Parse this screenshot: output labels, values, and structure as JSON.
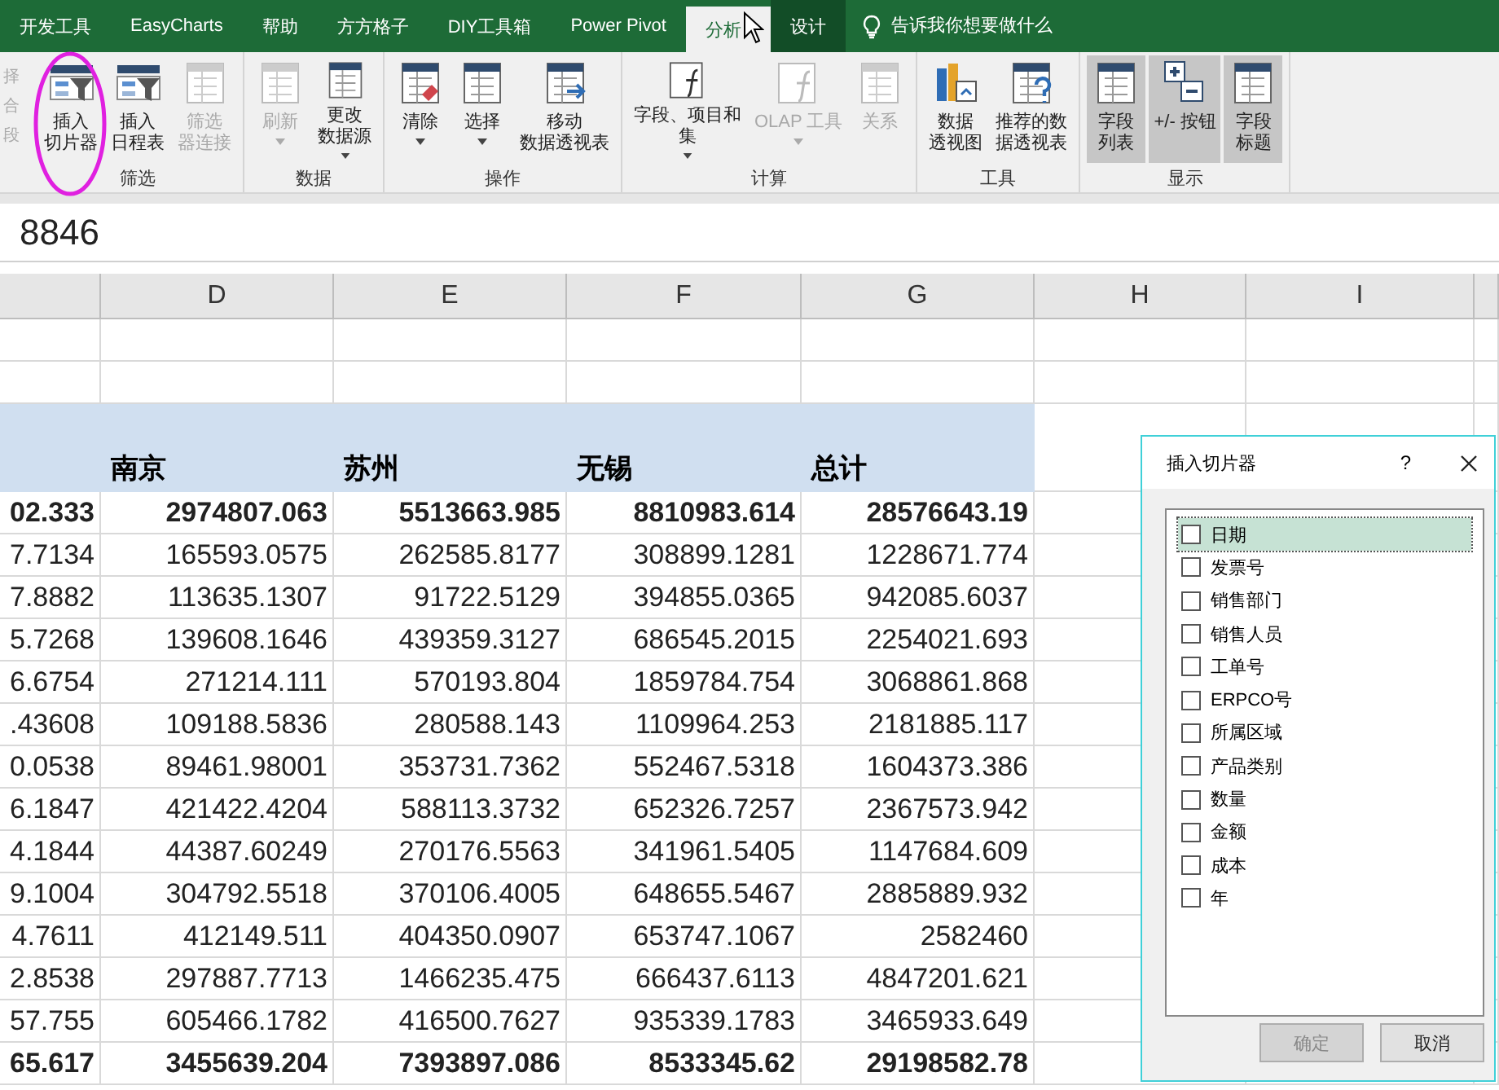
{
  "tabs": [
    {
      "label": "开发工具",
      "selected": false,
      "contextual": false
    },
    {
      "label": "EasyCharts",
      "selected": false,
      "contextual": false
    },
    {
      "label": "帮助",
      "selected": false,
      "contextual": false
    },
    {
      "label": "方方格子",
      "selected": false,
      "contextual": false
    },
    {
      "label": "DIY工具箱",
      "selected": false,
      "contextual": false
    },
    {
      "label": "Power Pivot",
      "selected": false,
      "contextual": false
    },
    {
      "label": "分析",
      "selected": true,
      "contextual": true
    },
    {
      "label": "设计",
      "selected": false,
      "contextual": true
    }
  ],
  "tell_me": {
    "placeholder": "告诉我你想要做什么"
  },
  "ribbon_partial_items": [
    "择",
    "合",
    "段"
  ],
  "ribbon_groups": [
    {
      "label": "筛选",
      "buttons": [
        {
          "lines": [
            "插入",
            "切片器"
          ],
          "disabled": false,
          "dropdown": false,
          "pressed": false,
          "circled": true
        },
        {
          "lines": [
            "插入",
            "日程表"
          ],
          "disabled": false,
          "dropdown": false,
          "pressed": false,
          "circled": false
        },
        {
          "lines": [
            "筛选",
            "器连接"
          ],
          "disabled": true,
          "dropdown": false,
          "pressed": false,
          "circled": false
        }
      ]
    },
    {
      "label": "数据",
      "buttons": [
        {
          "lines": [
            "刷新"
          ],
          "disabled": true,
          "dropdown": true,
          "pressed": false,
          "circled": false
        },
        {
          "lines": [
            "更改",
            "数据源"
          ],
          "disabled": false,
          "dropdown": true,
          "pressed": false,
          "circled": false
        }
      ]
    },
    {
      "label": "操作",
      "buttons": [
        {
          "lines": [
            "清除"
          ],
          "disabled": false,
          "dropdown": true,
          "pressed": false,
          "circled": false
        },
        {
          "lines": [
            "选择"
          ],
          "disabled": false,
          "dropdown": true,
          "pressed": false,
          "circled": false
        },
        {
          "lines": [
            "移动",
            "数据透视表"
          ],
          "disabled": false,
          "dropdown": false,
          "pressed": false,
          "circled": false
        }
      ]
    },
    {
      "label": "计算",
      "buttons": [
        {
          "lines": [
            "字段、项目和",
            "集"
          ],
          "disabled": false,
          "dropdown": true,
          "pressed": false,
          "circled": false
        },
        {
          "lines": [
            "OLAP 工具"
          ],
          "disabled": true,
          "dropdown": true,
          "pressed": false,
          "circled": false
        },
        {
          "lines": [
            "关系"
          ],
          "disabled": true,
          "dropdown": false,
          "pressed": false,
          "circled": false
        }
      ]
    },
    {
      "label": "工具",
      "buttons": [
        {
          "lines": [
            "数据",
            "透视图"
          ],
          "disabled": false,
          "dropdown": false,
          "pressed": false,
          "circled": false
        },
        {
          "lines": [
            "推荐的数",
            "据透视表"
          ],
          "disabled": false,
          "dropdown": false,
          "pressed": false,
          "circled": false
        }
      ]
    },
    {
      "label": "显示",
      "buttons": [
        {
          "lines": [
            "字段",
            "列表"
          ],
          "disabled": false,
          "dropdown": false,
          "pressed": true,
          "circled": false
        },
        {
          "lines": [
            "+/- 按钮"
          ],
          "disabled": false,
          "dropdown": false,
          "pressed": true,
          "circled": false
        },
        {
          "lines": [
            "字段",
            "标题"
          ],
          "disabled": false,
          "dropdown": false,
          "pressed": true,
          "circled": false
        }
      ]
    }
  ],
  "formula_bar": {
    "value": "8846"
  },
  "sheet": {
    "columns": [
      "",
      "D",
      "E",
      "F",
      "G",
      "H",
      "I"
    ],
    "header_row": [
      "南京",
      "苏州",
      "无锡",
      "总计"
    ],
    "rows": [
      {
        "kind": "total",
        "cells": [
          "02.333",
          "2974807.063",
          "5513663.985",
          "8810983.614",
          "28576643.19"
        ]
      },
      {
        "kind": "data",
        "cells": [
          "7.7134",
          "165593.0575",
          "262585.8177",
          "308899.1281",
          "1228671.774"
        ]
      },
      {
        "kind": "data",
        "cells": [
          "7.8882",
          "113635.1307",
          "91722.5129",
          "394855.0365",
          "942085.6037"
        ]
      },
      {
        "kind": "data",
        "cells": [
          "5.7268",
          "139608.1646",
          "439359.3127",
          "686545.2015",
          "2254021.693"
        ]
      },
      {
        "kind": "data",
        "cells": [
          "6.6754",
          "271214.111",
          "570193.804",
          "1859784.754",
          "3068861.868"
        ]
      },
      {
        "kind": "data",
        "cells": [
          ".43608",
          "109188.5836",
          "280588.143",
          "1109964.253",
          "2181885.117"
        ]
      },
      {
        "kind": "data",
        "cells": [
          "0.0538",
          "89461.98001",
          "353731.7362",
          "552467.5318",
          "1604373.386"
        ]
      },
      {
        "kind": "data",
        "cells": [
          "6.1847",
          "421422.4204",
          "588113.3732",
          "652326.7257",
          "2367573.942"
        ]
      },
      {
        "kind": "data",
        "cells": [
          "4.1844",
          "44387.60249",
          "270176.5563",
          "341961.5405",
          "1147684.609"
        ]
      },
      {
        "kind": "data",
        "cells": [
          "9.1004",
          "304792.5518",
          "370106.4005",
          "648655.5467",
          "2885889.932"
        ]
      },
      {
        "kind": "data",
        "cells": [
          "4.7611",
          "412149.511",
          "404350.0907",
          "653747.1067",
          "2582460"
        ]
      },
      {
        "kind": "data",
        "cells": [
          "2.8538",
          "297887.7713",
          "1466235.475",
          "666437.6113",
          "4847201.621"
        ]
      },
      {
        "kind": "data",
        "cells": [
          "57.755",
          "605466.1782",
          "416500.7627",
          "935339.1783",
          "3465933.649"
        ]
      },
      {
        "kind": "total",
        "cells": [
          "65.617",
          "3455639.204",
          "7393897.086",
          "8533345.62",
          "29198582.78"
        ]
      }
    ]
  },
  "dialog": {
    "title": "插入切片器",
    "help": "?",
    "fields": [
      {
        "label": "日期",
        "checked": false,
        "selected": true
      },
      {
        "label": "发票号",
        "checked": false,
        "selected": false
      },
      {
        "label": "销售部门",
        "checked": false,
        "selected": false
      },
      {
        "label": "销售人员",
        "checked": false,
        "selected": false
      },
      {
        "label": "工单号",
        "checked": false,
        "selected": false
      },
      {
        "label": "ERPCO号",
        "checked": false,
        "selected": false
      },
      {
        "label": "所属区域",
        "checked": false,
        "selected": false
      },
      {
        "label": "产品类别",
        "checked": false,
        "selected": false
      },
      {
        "label": "数量",
        "checked": false,
        "selected": false
      },
      {
        "label": "金额",
        "checked": false,
        "selected": false
      },
      {
        "label": "成本",
        "checked": false,
        "selected": false
      },
      {
        "label": "年",
        "checked": false,
        "selected": false
      }
    ],
    "buttons": [
      {
        "label": "确定",
        "disabled": true
      },
      {
        "label": "取消",
        "disabled": false
      }
    ]
  }
}
